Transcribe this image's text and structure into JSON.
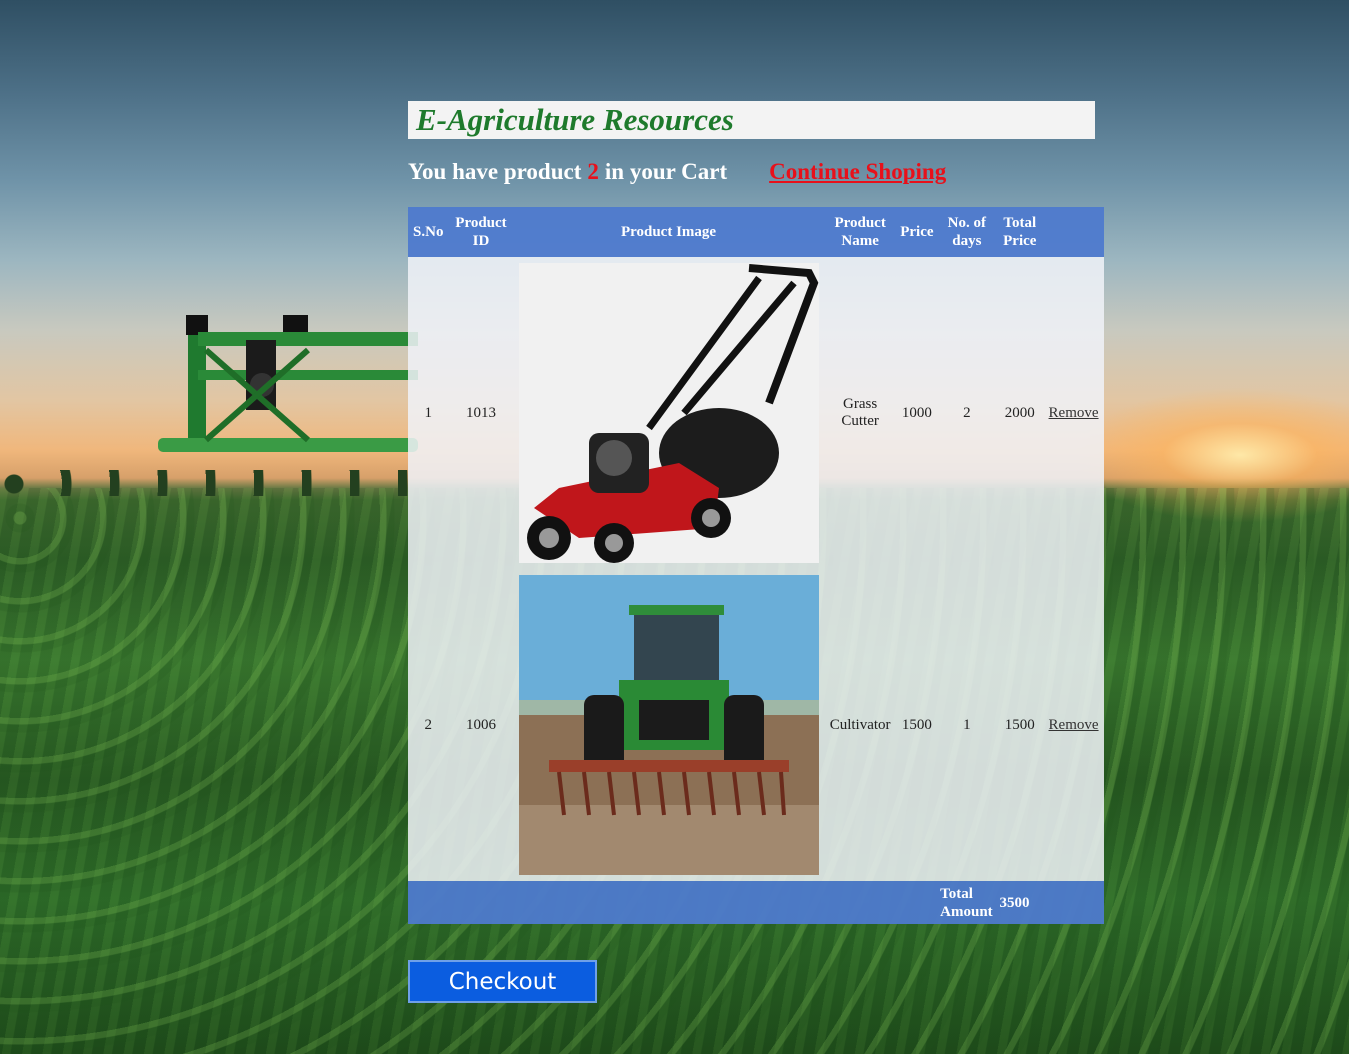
{
  "header": {
    "title": "E-Agriculture Resources"
  },
  "cart_summary": {
    "prefix": "You have product",
    "count": "2",
    "suffix": "in your Cart",
    "continue_link": "Continue Shoping"
  },
  "table": {
    "headers": {
      "sno": "S.No",
      "product_id": "Product ID",
      "product_image": "Product Image",
      "product_name": "Product Name",
      "price": "Price",
      "days": "No. of days",
      "total_price": "Total Price"
    },
    "rows": [
      {
        "sno": "1",
        "product_id": "1013",
        "image": "lawn-mower-image",
        "product_name": "Grass Cutter",
        "price": "1000",
        "days": "2",
        "total_price": "2000",
        "action": "Remove"
      },
      {
        "sno": "2",
        "product_id": "1006",
        "image": "tractor-cultivator-image",
        "product_name": "Cultivator",
        "price": "1500",
        "days": "1",
        "total_price": "1500",
        "action": "Remove"
      }
    ],
    "footer": {
      "label": "Total Amount",
      "value": "3500"
    }
  },
  "checkout": {
    "label": "Checkout"
  }
}
